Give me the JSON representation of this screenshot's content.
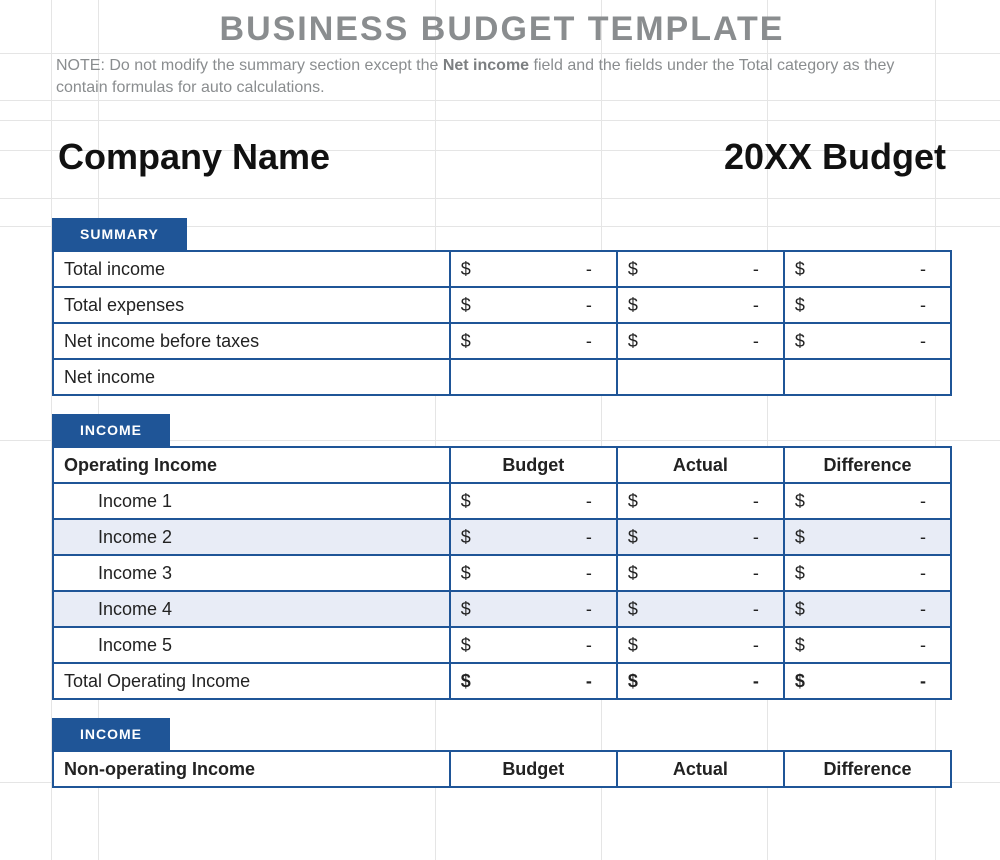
{
  "title": "BUSINESS BUDGET TEMPLATE",
  "note_pre": "NOTE: Do not modify the summary section except the ",
  "note_bold": "Net income",
  "note_post": " field and the fields under the Total category as they contain formulas for auto calculations.",
  "company_label": "Company Name",
  "budget_year_label": "20XX Budget",
  "currency": "$",
  "dash": "-",
  "tabs": {
    "summary": "SUMMARY",
    "income1": "INCOME",
    "income2": "INCOME"
  },
  "columns": {
    "budget": "Budget",
    "actual": "Actual",
    "difference": "Difference"
  },
  "summary_rows": [
    {
      "label": "Total income",
      "budget": "-",
      "actual": "-",
      "difference": "-"
    },
    {
      "label": "Total expenses",
      "budget": "-",
      "actual": "-",
      "difference": "-"
    },
    {
      "label": "Net income before taxes",
      "budget": "-",
      "actual": "-",
      "difference": "-"
    },
    {
      "label": "Net income",
      "budget": "",
      "actual": "",
      "difference": ""
    }
  ],
  "operating": {
    "header": "Operating Income",
    "rows": [
      {
        "label": "Income 1",
        "budget": "-",
        "actual": "-",
        "difference": "-"
      },
      {
        "label": "Income 2",
        "budget": "-",
        "actual": "-",
        "difference": "-"
      },
      {
        "label": "Income 3",
        "budget": "-",
        "actual": "-",
        "difference": "-"
      },
      {
        "label": "Income 4",
        "budget": "-",
        "actual": "-",
        "difference": "-"
      },
      {
        "label": "Income 5",
        "budget": "-",
        "actual": "-",
        "difference": "-"
      }
    ],
    "total_label": "Total Operating Income",
    "total": {
      "budget": "-",
      "actual": "-",
      "difference": "-"
    }
  },
  "nonoperating": {
    "header": "Non-operating Income"
  }
}
